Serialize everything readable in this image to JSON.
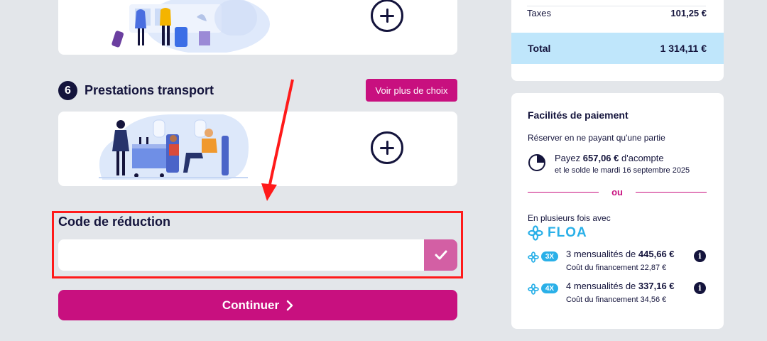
{
  "transport_section": {
    "step_number": "6",
    "title": "Prestations transport",
    "more_choices_label": "Voir plus de choix"
  },
  "promo": {
    "label": "Code de réduction",
    "value": "",
    "placeholder": ""
  },
  "continue_label": "Continuer",
  "summary": {
    "taxes_label": "Taxes",
    "taxes_value": "101,25 €",
    "total_label": "Total",
    "total_value": "1 314,11 €"
  },
  "payment": {
    "title": "Facilités de paiement",
    "partial_label": "Réserver en ne payant qu'une partie",
    "deposit_prefix": "Payez",
    "deposit_amount": "657,06 €",
    "deposit_suffix": "d'acompte",
    "balance_text": "et le solde le mardi 16 septembre 2025",
    "or_label": "ou",
    "multi_label": "En plusieurs fois avec",
    "provider": "FLOA",
    "installments": [
      {
        "badge": "3X",
        "prefix": "3 mensualités de",
        "amount": "445,66 €",
        "cost": "Coût du financement 22,87 €"
      },
      {
        "badge": "4X",
        "prefix": "4 mensualités de",
        "amount": "337,16 €",
        "cost": "Coût du financement 34,56 €"
      }
    ]
  },
  "colors": {
    "brand_magenta": "#c8107f",
    "navy": "#14143c",
    "floa_blue": "#2ab0e8",
    "total_bg": "#bfe6fb",
    "annotation_red": "#ff1a1a"
  }
}
